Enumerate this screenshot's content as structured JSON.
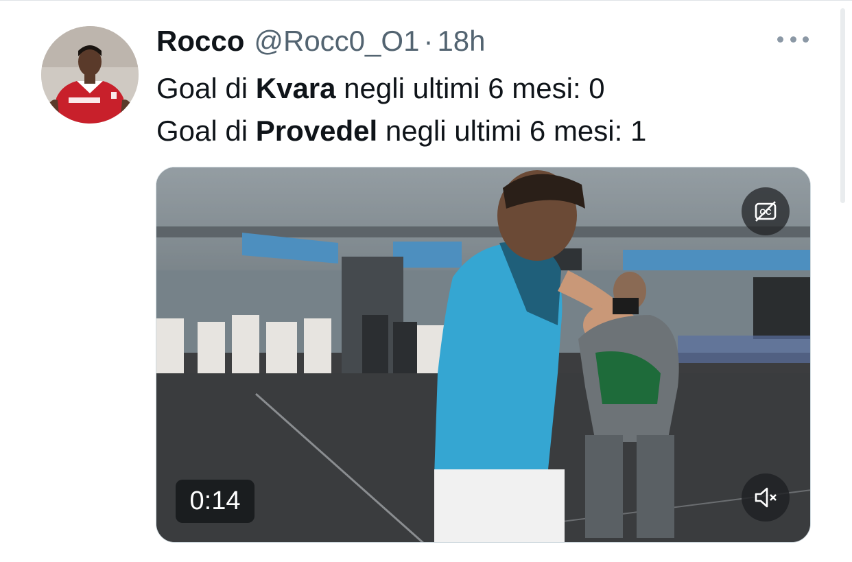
{
  "tweet": {
    "author": {
      "display_name": "Rocco",
      "handle": "@Rocc0_O1",
      "separator": "·",
      "time": "18h",
      "avatar_icon": "avatar-player-photo"
    },
    "more_icon": "more-dots-icon",
    "text_lines": [
      {
        "prefix": "Goal di ",
        "bold": "Kvara",
        "suffix": " negli ultimi 6 mesi: 0"
      },
      {
        "prefix": "Goal di ",
        "bold": "Provedel",
        "suffix": " negli ultimi 6 mesi: 1"
      }
    ],
    "media": {
      "type": "video",
      "duration": "0:14",
      "cc_icon": "closed-captions-off-icon",
      "mute_icon": "volume-muted-icon"
    }
  },
  "colors": {
    "text_primary": "#0f1419",
    "text_secondary": "#536471",
    "overlay": "#1e2023",
    "jersey": "#35a6d2"
  }
}
